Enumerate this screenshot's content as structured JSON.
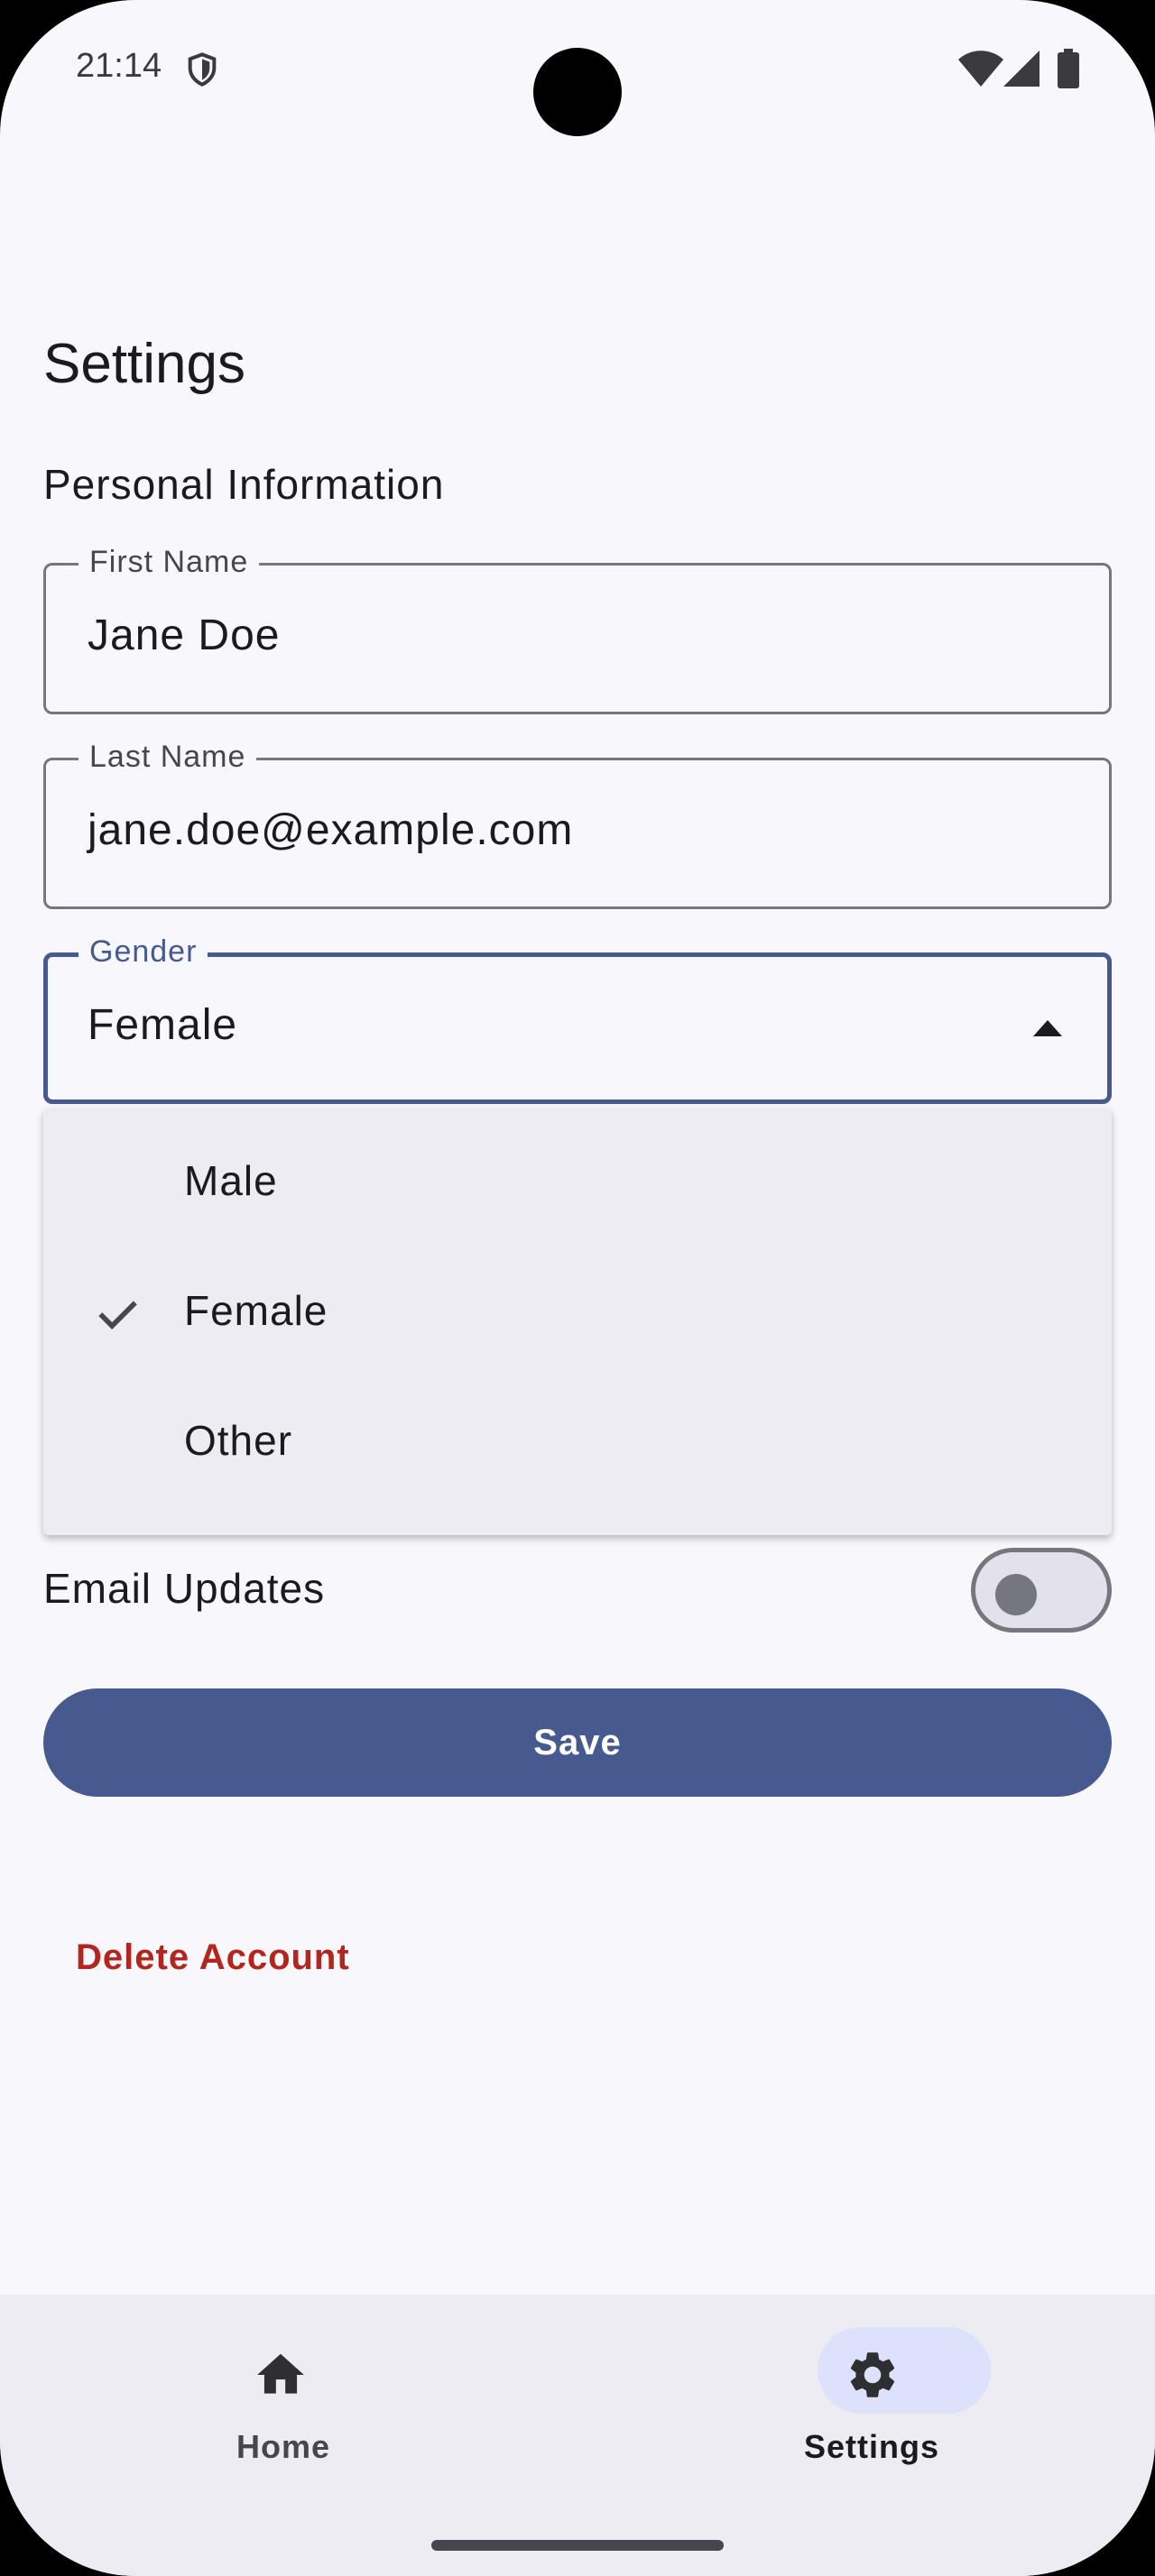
{
  "status_bar": {
    "time": "21:14"
  },
  "page": {
    "title": "Settings",
    "section": "Personal Information"
  },
  "fields": {
    "first_name": {
      "label": "First Name",
      "value": "Jane Doe"
    },
    "last_name": {
      "label": "Last Name",
      "value": "jane.doe@example.com"
    },
    "gender": {
      "label": "Gender",
      "value": "Female"
    }
  },
  "gender_menu": {
    "options": [
      "Male",
      "Female",
      "Other"
    ],
    "selected": "Female"
  },
  "email_updates": {
    "label": "Email Updates",
    "enabled": false
  },
  "actions": {
    "save": "Save",
    "delete": "Delete Account"
  },
  "bottom_nav": {
    "items": [
      {
        "label": "Home",
        "icon": "home-icon"
      },
      {
        "label": "Settings",
        "icon": "gear-icon",
        "active": true
      }
    ]
  },
  "colors": {
    "primary": "#465a90",
    "danger": "#b3261e",
    "nav_indicator": "#dde1f9"
  }
}
